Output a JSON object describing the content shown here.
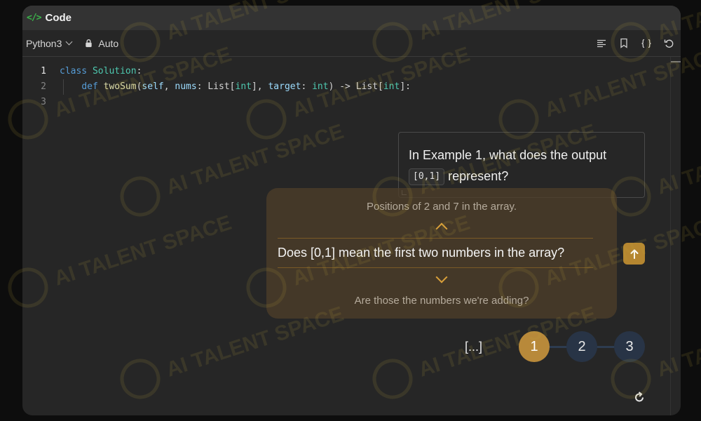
{
  "panel": {
    "title": "Code",
    "title_icon": "</>"
  },
  "toolbar": {
    "language": "Python3",
    "mode": "Auto",
    "icons": [
      "format-icon",
      "bookmark-icon",
      "braces-icon",
      "undo-icon"
    ]
  },
  "editor": {
    "line_numbers": [
      "1",
      "2",
      "3"
    ],
    "lines": [
      [
        {
          "t": "class ",
          "c": "kw"
        },
        {
          "t": "Solution",
          "c": "cls"
        },
        {
          "t": ":",
          "c": ""
        }
      ],
      [
        {
          "t": "    ",
          "c": ""
        },
        {
          "t": "def ",
          "c": "kw"
        },
        {
          "t": "twoSum",
          "c": "fn"
        },
        {
          "t": "(",
          "c": ""
        },
        {
          "t": "self",
          "c": "param"
        },
        {
          "t": ", ",
          "c": ""
        },
        {
          "t": "nums",
          "c": "param"
        },
        {
          "t": ": List[",
          "c": ""
        },
        {
          "t": "int",
          "c": "cls"
        },
        {
          "t": "], ",
          "c": ""
        },
        {
          "t": "target",
          "c": "param"
        },
        {
          "t": ": ",
          "c": ""
        },
        {
          "t": "int",
          "c": "cls"
        },
        {
          "t": ") -> List[",
          "c": ""
        },
        {
          "t": "int",
          "c": "cls"
        },
        {
          "t": "]:",
          "c": ""
        }
      ],
      []
    ]
  },
  "question": {
    "before": "In Example 1, what does the output",
    "code": "[0,1]",
    "after": "represent?"
  },
  "suggestions": {
    "previous": "Positions of 2 and 7 in the array.",
    "current": "Does [0,1] mean the first two numbers in the array?",
    "next": "Are those the numbers we're adding?"
  },
  "pager": {
    "ellipsis": "[...]",
    "pages": [
      "1",
      "2",
      "3"
    ],
    "active": "1"
  },
  "watermark": {
    "text": "AI TALENT SPACE"
  },
  "colors": {
    "accent_gold": "#b8893a",
    "page_inactive": "#283446",
    "code_icon_green": "#3bb34a",
    "suggest_bg": "#4d3d29"
  }
}
